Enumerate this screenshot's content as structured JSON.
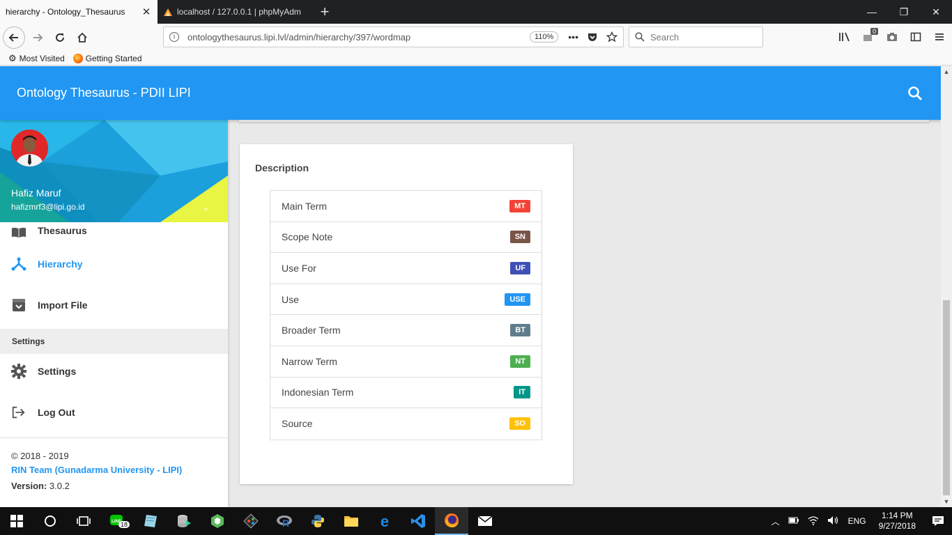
{
  "browser": {
    "tabs": [
      {
        "title": "hierarchy - Ontology_Thesaurus",
        "active": true
      },
      {
        "title": "localhost / 127.0.0.1 | phpMyAdm",
        "active": false
      }
    ],
    "url": "ontologythesaurus.lipi.lvl/admin/hierarchy/397/wordmap",
    "zoom": "110%",
    "search_placeholder": "Search",
    "sync_badge": "0",
    "bookmarks": [
      "Most Visited",
      "Getting Started"
    ]
  },
  "app": {
    "title": "Ontology Thesaurus - PDII LIPI",
    "accent_color": "#2196f3"
  },
  "sidebar": {
    "user": {
      "name": "Hafiz Maruf",
      "email": "hafizmrf3@lipi.go.id"
    },
    "items": [
      {
        "label": "Thesaurus",
        "icon": "book-icon"
      },
      {
        "label": "Hierarchy",
        "icon": "hierarchy-icon",
        "active": true
      },
      {
        "label": "Import File",
        "icon": "archive-icon"
      }
    ],
    "section_header": "Settings",
    "settings_items": [
      {
        "label": "Settings",
        "icon": "gear-icon"
      },
      {
        "label": "Log Out",
        "icon": "logout-icon"
      }
    ],
    "legal": {
      "copyright": "© 2018 - 2019",
      "team": "RIN Team (Gunadarma University - LIPI)",
      "version_label": "Version:",
      "version_value": " 3.0.2"
    }
  },
  "description": {
    "header": "Description",
    "items": [
      {
        "label": "Main Term",
        "code": "MT",
        "color": "#f44336"
      },
      {
        "label": "Scope Note",
        "code": "SN",
        "color": "#795548"
      },
      {
        "label": "Use For",
        "code": "UF",
        "color": "#3f51b5"
      },
      {
        "label": "Use",
        "code": "USE",
        "color": "#2196f3"
      },
      {
        "label": "Broader Term",
        "code": "BT",
        "color": "#607d8b"
      },
      {
        "label": "Narrow Term",
        "code": "NT",
        "color": "#4caf50"
      },
      {
        "label": "Indonesian Term",
        "code": "IT",
        "color": "#009688"
      },
      {
        "label": "Source",
        "code": "SO",
        "color": "#ffc107"
      }
    ]
  },
  "taskbar": {
    "line_badge": "18",
    "language": "ENG",
    "time": "1:14 PM",
    "date": "9/27/2018"
  }
}
